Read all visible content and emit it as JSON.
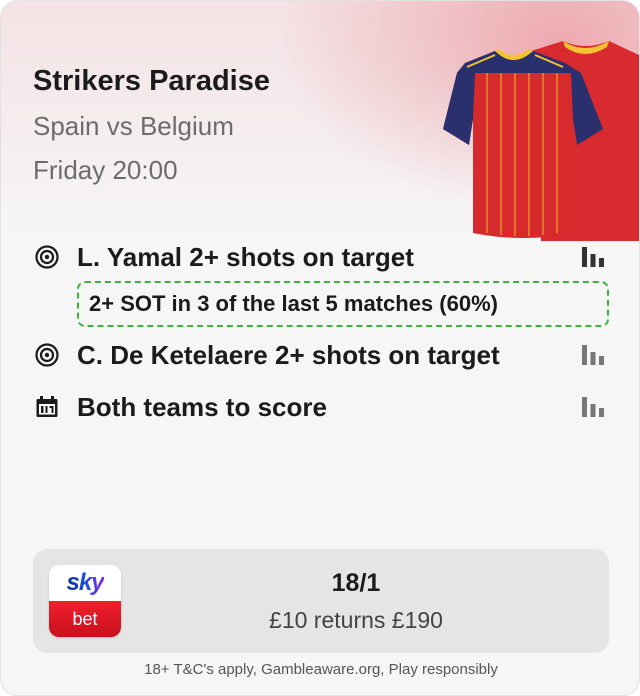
{
  "card": {
    "title": "Strikers Paradise",
    "match": "Spain vs Belgium",
    "kickoff": "Friday 20:00"
  },
  "selections": [
    {
      "icon": "target-icon",
      "label": "L. Yamal 2+ shots on target",
      "stats_icon": "bar-chart-icon"
    },
    {
      "icon": "target-icon",
      "label": "C. De Ketelaere 2+ shots on target",
      "stats_icon": "bar-chart-icon"
    },
    {
      "icon": "calendar-icon",
      "label": "Both teams to score",
      "stats_icon": "bar-chart-icon"
    }
  ],
  "stat_highlight": "2+ SOT in 3 of the last 5 matches (60%)",
  "odds_panel": {
    "logo_top": "sky",
    "logo_bottom": "bet",
    "odds": "18/1",
    "returns": "£10 returns £190"
  },
  "footer": {
    "disclaimer": "18+ T&C's apply, Gambleaware.org, Play responsibly"
  },
  "colors": {
    "accent_green": "#3cb43c",
    "kit_red": "#d8282e",
    "kit_navy": "#2a2f6e",
    "sky_red": "#e01b24",
    "sky_blue": "#0a2d9c"
  }
}
